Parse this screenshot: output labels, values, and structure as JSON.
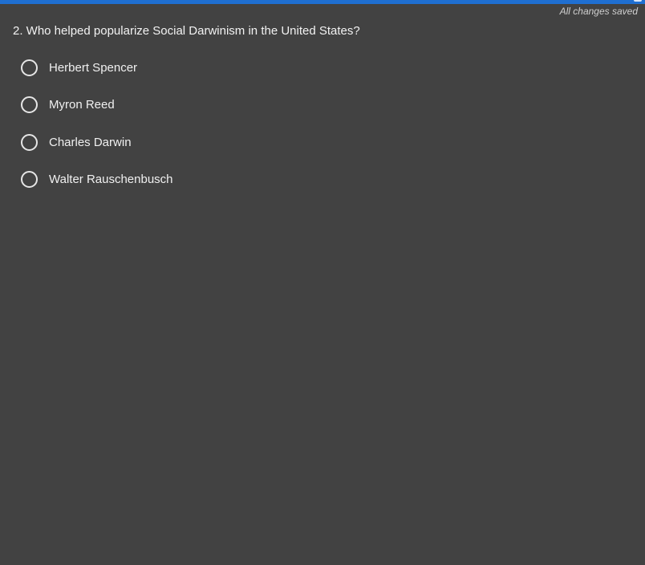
{
  "status": {
    "save_text": "All changes saved"
  },
  "question": {
    "text": "2. Who helped popularize Social Darwinism in the United States?",
    "options": [
      {
        "label": "Herbert Spencer",
        "selected": false
      },
      {
        "label": "Myron Reed",
        "selected": false
      },
      {
        "label": "Charles Darwin",
        "selected": false
      },
      {
        "label": "Walter Rauschenbusch",
        "selected": false
      }
    ]
  },
  "colors": {
    "background": "#424242",
    "accent_bar": "#1f6fd1",
    "text": "#f2f2f2",
    "muted_text": "#cfcfcf"
  }
}
